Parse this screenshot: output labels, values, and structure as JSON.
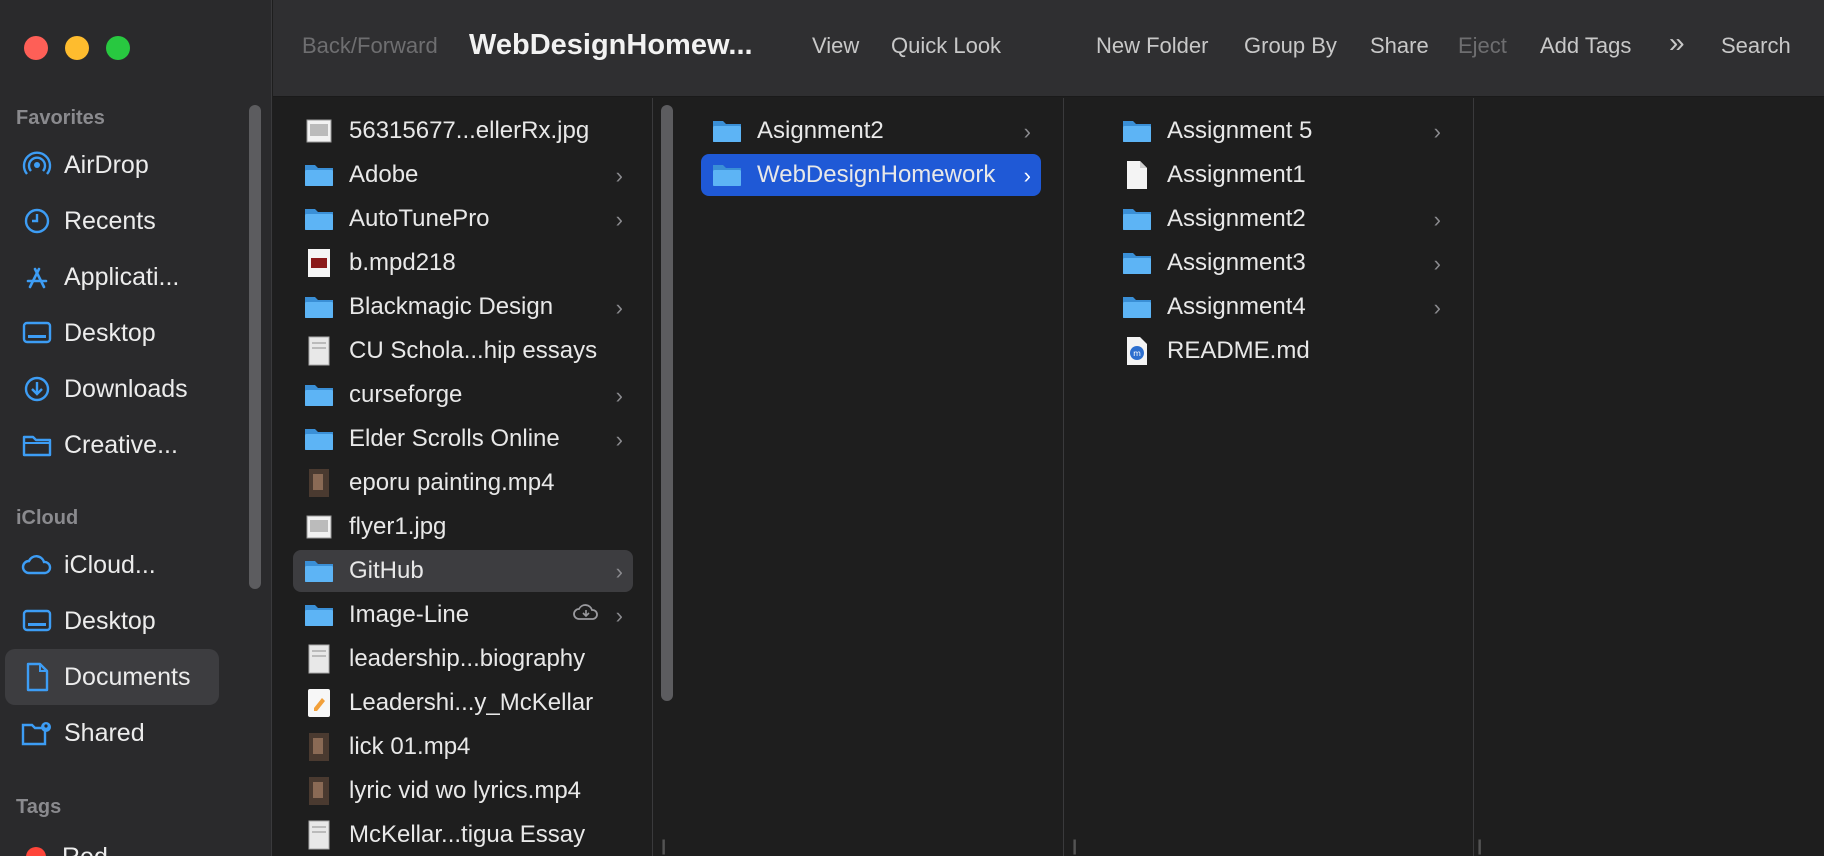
{
  "window": {
    "title": "WebDesignHomew..."
  },
  "toolbar": {
    "back_forward": "Back/Forward",
    "view": "View",
    "quick_look": "Quick Look",
    "new_folder": "New Folder",
    "group_by": "Group By",
    "share": "Share",
    "eject": "Eject",
    "add_tags": "Add Tags",
    "more": "»",
    "search": "Search"
  },
  "sidebar": {
    "favorites_title": "Favorites",
    "favorites": [
      {
        "label": "AirDrop",
        "icon": "airdrop-icon"
      },
      {
        "label": "Recents",
        "icon": "clock-icon"
      },
      {
        "label": "Applicati...",
        "icon": "applications-icon"
      },
      {
        "label": "Desktop",
        "icon": "desktop-icon"
      },
      {
        "label": "Downloads",
        "icon": "downloads-icon"
      },
      {
        "label": "Creative...",
        "icon": "folder-icon"
      }
    ],
    "icloud_title": "iCloud",
    "icloud": [
      {
        "label": "iCloud...",
        "icon": "cloud-icon"
      },
      {
        "label": "Desktop",
        "icon": "desktop-icon"
      },
      {
        "label": "Documents",
        "icon": "document-icon",
        "selected": true
      },
      {
        "label": "Shared",
        "icon": "shared-folder-icon"
      }
    ],
    "tags_title": "Tags",
    "tags": [
      {
        "label": "Red",
        "color": "#ff453a"
      }
    ]
  },
  "column1": {
    "items": [
      {
        "label": "56315677...ellerRx.jpg",
        "kind": "image"
      },
      {
        "label": "Adobe",
        "kind": "folder",
        "chevron": true
      },
      {
        "label": "AutoTunePro",
        "kind": "folder",
        "chevron": true
      },
      {
        "label": "b.mpd218",
        "kind": "binary"
      },
      {
        "label": "Blackmagic Design",
        "kind": "folder",
        "chevron": true
      },
      {
        "label": "CU Schola...hip essays",
        "kind": "doc"
      },
      {
        "label": "curseforge",
        "kind": "folder",
        "chevron": true
      },
      {
        "label": "Elder Scrolls Online",
        "kind": "folder",
        "chevron": true
      },
      {
        "label": "eporu painting.mp4",
        "kind": "video"
      },
      {
        "label": "flyer1.jpg",
        "kind": "image"
      },
      {
        "label": "GitHub",
        "kind": "folder",
        "chevron": true,
        "selected": true
      },
      {
        "label": "Image-Line",
        "kind": "folder",
        "chevron": true,
        "cloud": true
      },
      {
        "label": "leadership...biography",
        "kind": "doc"
      },
      {
        "label": "Leadershi...y_McKellar",
        "kind": "pages"
      },
      {
        "label": "lick 01.mp4",
        "kind": "video"
      },
      {
        "label": "lyric vid wo lyrics.mp4",
        "kind": "video"
      },
      {
        "label": "McKellar...tigua Essay",
        "kind": "doc"
      }
    ]
  },
  "column2": {
    "items": [
      {
        "label": "Asignment2",
        "kind": "folder",
        "chevron": true
      },
      {
        "label": "WebDesignHomework",
        "kind": "folder",
        "chevron": true,
        "selected": true
      }
    ]
  },
  "column3": {
    "items": [
      {
        "label": "Assignment 5",
        "kind": "folder",
        "chevron": true
      },
      {
        "label": "Assignment1",
        "kind": "blank"
      },
      {
        "label": "Assignment2",
        "kind": "folder",
        "chevron": true
      },
      {
        "label": "Assignment3",
        "kind": "folder",
        "chevron": true
      },
      {
        "label": "Assignment4",
        "kind": "folder",
        "chevron": true
      },
      {
        "label": "README.md",
        "kind": "markdown"
      }
    ]
  },
  "colors": {
    "accent": "#1f59d6",
    "folder": "#4aa9f2",
    "sidebar_icon": "#3d9df5"
  }
}
